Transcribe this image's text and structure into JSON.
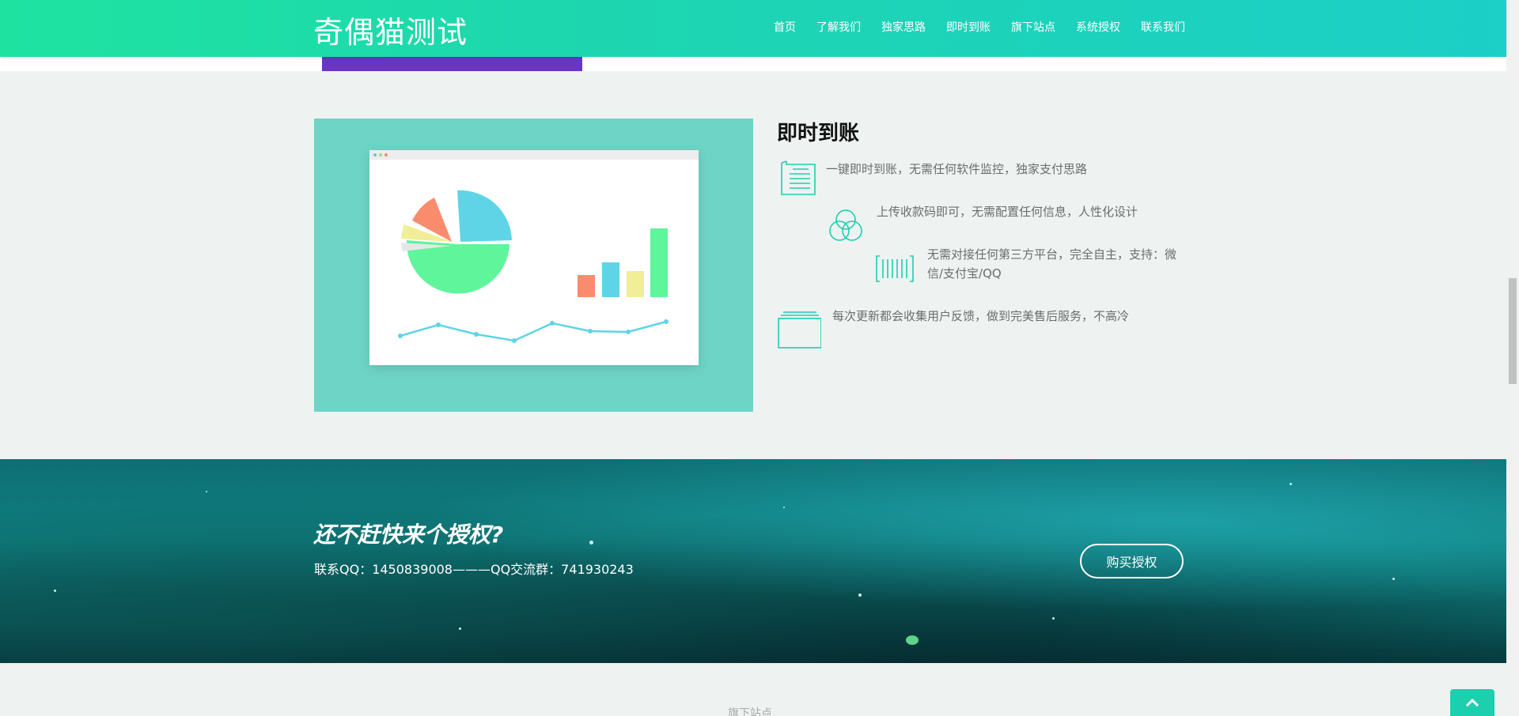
{
  "header": {
    "brand": "奇偶猫测试",
    "nav": [
      "首页",
      "了解我们",
      "独家思路",
      "即时到账",
      "旗下站点",
      "系统授权",
      "联系我们"
    ]
  },
  "feature": {
    "title": "即时到账",
    "items": [
      {
        "icon": "document-icon",
        "text": "一键即时到账，无需任何软件监控，独家支付思路"
      },
      {
        "icon": "circles-icon",
        "text": "上传收款码即可，无需配置任何信息，人性化设计"
      },
      {
        "icon": "barcode-icon",
        "text": "无需对接任何第三方平台，完全自主，支持：微信/支付宝/QQ"
      },
      {
        "icon": "stack-icon",
        "text": "每次更新都会收集用户反馈，做到完美售后服务，不高冷"
      }
    ]
  },
  "banner": {
    "title": "还不赶快来个授权?",
    "subtitle": "联系QQ：1450839008———QQ交流群：741930243",
    "button": "购买授权"
  },
  "footer_hint": "旗下站点",
  "colors": {
    "accent": "#1ccfae",
    "purple": "#6a35c2",
    "illustration_bg": "#6ed4c6"
  }
}
